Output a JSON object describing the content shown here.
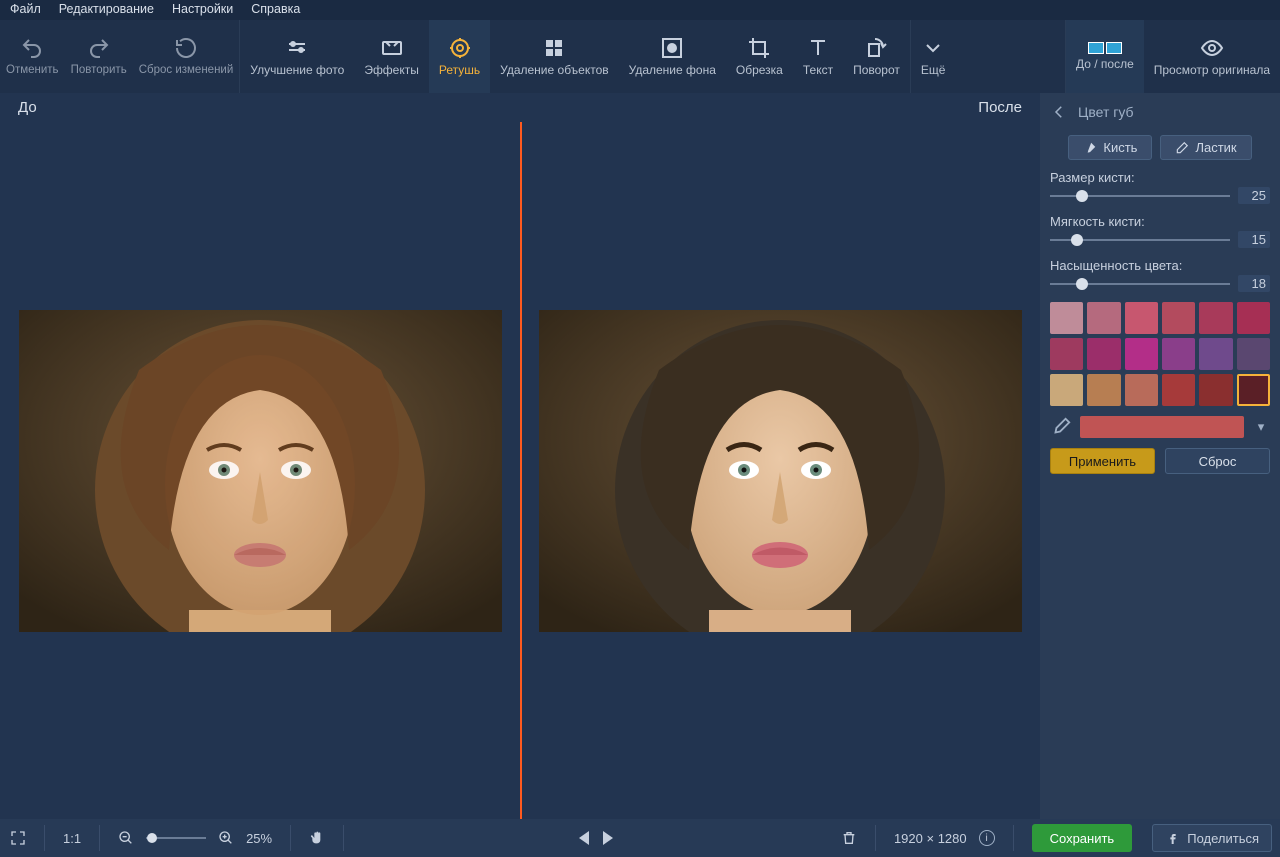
{
  "menubar": {
    "file": "Файл",
    "edit": "Редактирование",
    "settings": "Настройки",
    "help": "Справка"
  },
  "toolbar": {
    "undo": "Отменить",
    "redo": "Повторить",
    "reset": "Сброс изменений",
    "enhance": "Улучшение фото",
    "effects": "Эффекты",
    "retouch": "Ретушь",
    "object_removal": "Удаление объектов",
    "bg_removal": "Удаление фона",
    "crop": "Обрезка",
    "text": "Текст",
    "rotate": "Поворот",
    "more": "Ещё",
    "before_after": "До / после",
    "view_original": "Просмотр оригинала"
  },
  "canvas": {
    "before_label": "До",
    "after_label": "После"
  },
  "sidebar": {
    "title": "Цвет губ",
    "brush": "Кисть",
    "eraser": "Ластик",
    "size_label": "Размер кисти:",
    "size_value": "25",
    "soft_label": "Мягкость кисти:",
    "soft_value": "15",
    "sat_label": "Насыщенность цвета:",
    "sat_value": "18",
    "swatches": [
      "#bf8c99",
      "#b56a7e",
      "#c7576f",
      "#b34b5e",
      "#a83a5a",
      "#a62f54",
      "#9e3a5f",
      "#9b2e6a",
      "#b32e88",
      "#8a3e8a",
      "#6f4a8c",
      "#5a4770",
      "#c9a87a",
      "#b77e52",
      "#b86b5a",
      "#a63a3a",
      "#8a2f2f",
      "#5a1f26"
    ],
    "selected_swatch_index": 17,
    "picked_color": "#c05454",
    "apply": "Применить",
    "reset": "Сброс"
  },
  "bottom": {
    "scale_label": "1:1",
    "zoom_value": "25%",
    "dimensions": "1920 × 1280",
    "save": "Сохранить",
    "share": "Поделиться"
  }
}
